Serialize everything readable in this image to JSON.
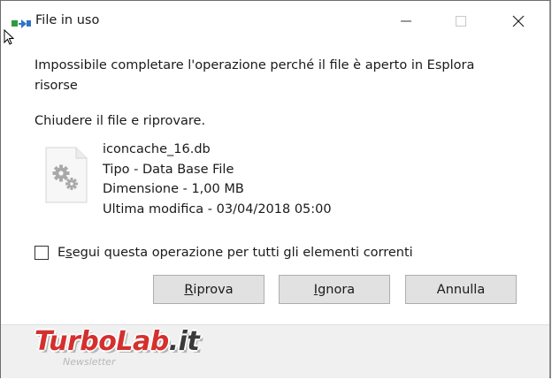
{
  "window": {
    "title": "File in uso",
    "icon": "file-transfer-icon"
  },
  "message": {
    "main": "Impossibile completare l'operazione perché il file è aperto in Esplora risorse",
    "hint": "Chiudere il file e riprovare."
  },
  "file": {
    "icon": "settings-file-icon",
    "name": "iconcache_16.db",
    "type": "Tipo - Data Base File",
    "size": "Dimensione - 1,00 MB",
    "modified": "Ultima modifica - 03/04/2018 05:00"
  },
  "checkbox": {
    "label_prefix": "E",
    "label_access": "s",
    "label_rest": "egui questa operazione per tutti gli elementi correnti",
    "checked": false
  },
  "buttons": {
    "retry_access": "R",
    "retry_rest": "iprova",
    "ignore_access": "I",
    "ignore_rest": "gnora",
    "cancel": "Annulla"
  },
  "watermark": {
    "brand_red": "TurboLab",
    "brand_dark": ".it",
    "sub": "Newsletter"
  },
  "colors": {
    "button_bg": "#e1e1e1",
    "button_border": "#adadad",
    "footer_bg": "#f0f0f0",
    "watermark_red": "#d4302d"
  }
}
